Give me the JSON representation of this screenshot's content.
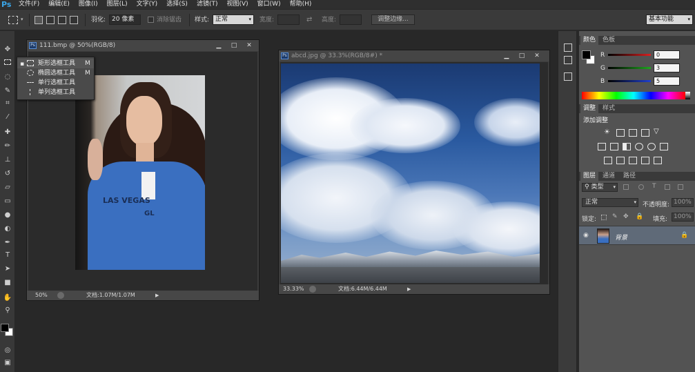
{
  "app": {
    "logo": "Ps"
  },
  "menu": [
    "文件(F)",
    "编辑(E)",
    "图像(I)",
    "图层(L)",
    "文字(Y)",
    "选择(S)",
    "滤镜(T)",
    "视图(V)",
    "窗口(W)",
    "帮助(H)"
  ],
  "options": {
    "feather_label": "羽化:",
    "feather_value": "20 像素",
    "antialias_label": "消除锯齿",
    "style_label": "样式:",
    "style_value": "正常",
    "width_label": "宽度:",
    "height_label": "高度:",
    "refine_edge": "调整边缘...",
    "workspace": "基本功能"
  },
  "flyout": [
    {
      "label": "矩形选框工具",
      "shortcut": "M"
    },
    {
      "label": "椭圆选框工具",
      "shortcut": "M"
    },
    {
      "label": "单行选框工具",
      "shortcut": ""
    },
    {
      "label": "单列选框工具",
      "shortcut": ""
    }
  ],
  "doc1": {
    "title": "111.bmp @ 50%(RGB/8)",
    "zoom": "50%",
    "doc_info": "文档:1.07M/1.07M",
    "shirt_text_1": "LAS VEGAS",
    "shirt_text_2": "GL"
  },
  "doc2": {
    "title": "abcd.jpg @ 33.3%(RGB/8#) *",
    "zoom": "33.33%",
    "doc_info": "文档:6.44M/6.44M"
  },
  "color_panel": {
    "tabs": [
      "颜色",
      "色板"
    ],
    "channels": [
      {
        "name": "R",
        "value": "0",
        "color": "#d92020"
      },
      {
        "name": "G",
        "value": "3",
        "color": "#1fa61f"
      },
      {
        "name": "B",
        "value": "5",
        "color": "#2040d0"
      }
    ]
  },
  "adjust_panel": {
    "tabs": [
      "调整",
      "样式"
    ],
    "heading": "添加调整"
  },
  "layers_panel": {
    "tabs": [
      "图层",
      "通道",
      "路径"
    ],
    "filter_value": "类型",
    "blend_mode": "正常",
    "opacity_label": "不透明度:",
    "opacity_value": "100%",
    "lock_label": "锁定:",
    "fill_label": "填充:",
    "fill_value": "100%",
    "layers": [
      {
        "name": "背景"
      }
    ]
  },
  "colors": {
    "accent": "#3aa5e8",
    "fg_swatch": "#000000",
    "bg_swatch": "#ffffff",
    "selected_layer": "#5f6a78"
  }
}
